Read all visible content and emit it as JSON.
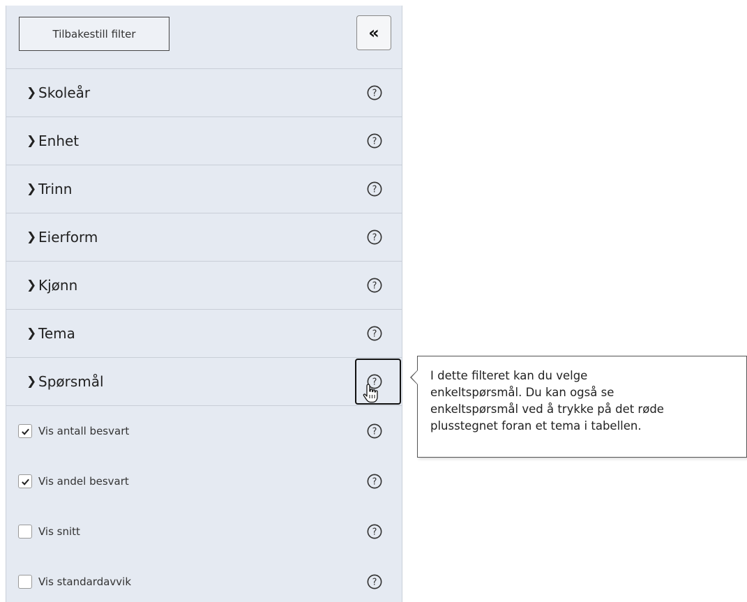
{
  "reset_button": "Tilbakestill filter",
  "collapse_button": "«",
  "filters": [
    {
      "label": "Skoleår"
    },
    {
      "label": "Enhet"
    },
    {
      "label": "Trinn"
    },
    {
      "label": "Eierform"
    },
    {
      "label": "Kjønn"
    },
    {
      "label": "Tema"
    },
    {
      "label": "Spørsmål"
    }
  ],
  "checkboxes": [
    {
      "label": "Vis antall besvart",
      "checked": true
    },
    {
      "label": "Vis andel besvart",
      "checked": true
    },
    {
      "label": "Vis snitt",
      "checked": false
    },
    {
      "label": "Vis standardavvik",
      "checked": false
    }
  ],
  "tooltip": {
    "lines": [
      "I dette filteret kan du velge",
      "enkeltspørsmål. Du kan også se",
      "enkeltspørsmål ved å trykke på det røde",
      "plusstegnet foran et tema i tabellen."
    ]
  },
  "icons": {
    "chevron": "chevron-right-icon",
    "help": "question-circle-icon",
    "collapse": "double-chevron-left-icon",
    "check": "checkmark-icon",
    "cursor": "hand-pointer-cursor-icon"
  }
}
